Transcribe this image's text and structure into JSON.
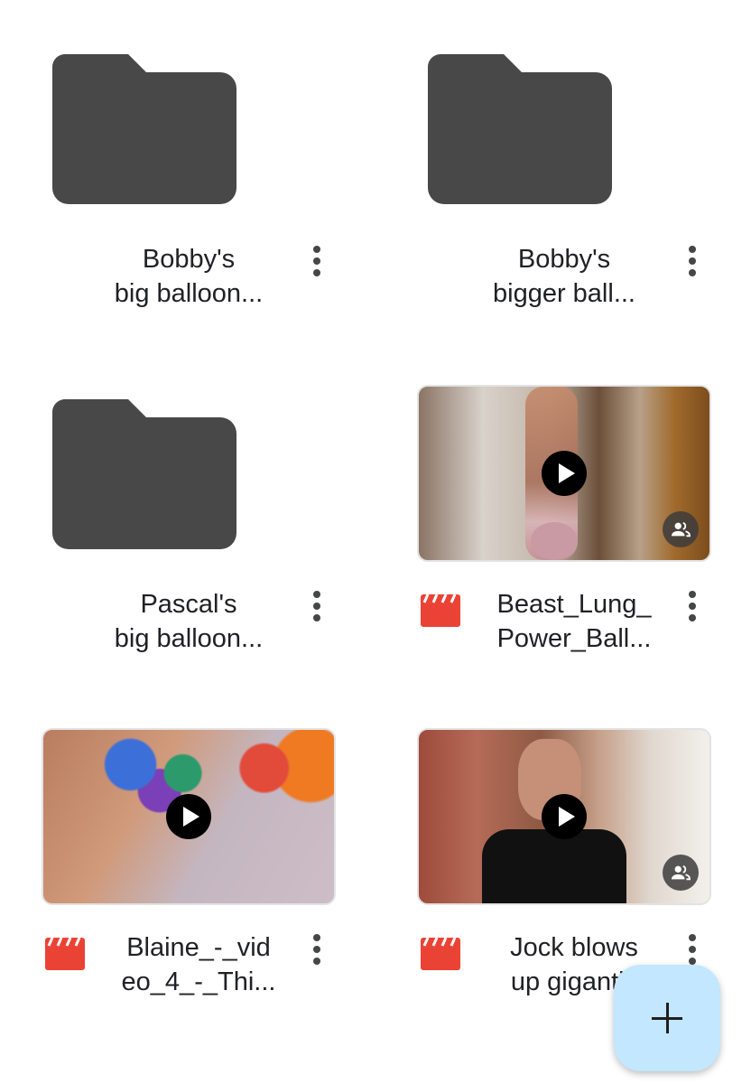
{
  "items": [
    {
      "type": "folder",
      "shared": true,
      "title_line1": "Bobby's",
      "title_line2": "big balloon..."
    },
    {
      "type": "folder",
      "shared": false,
      "title_line1": "Bobby's",
      "title_line2": "bigger ball..."
    },
    {
      "type": "folder",
      "shared": false,
      "title_line1": "Pascal's",
      "title_line2": "big balloon..."
    },
    {
      "type": "video",
      "shared": true,
      "title_line1": "Beast_Lung_",
      "title_line2": "Power_Ball..."
    },
    {
      "type": "video",
      "shared": false,
      "title_line1": "Blaine_-_vid",
      "title_line2": "eo_4_-_Thi..."
    },
    {
      "type": "video",
      "shared": true,
      "title_line1": "Jock blows",
      "title_line2": "up gigantic"
    }
  ],
  "colors": {
    "folder": "#484848",
    "video_icon": "#ea4335",
    "fab_bg": "#c2e7ff"
  },
  "icons": {
    "more": "more-vert-icon",
    "people": "people-icon",
    "video": "clapperboard-icon",
    "play": "play-icon",
    "add": "plus-icon"
  }
}
